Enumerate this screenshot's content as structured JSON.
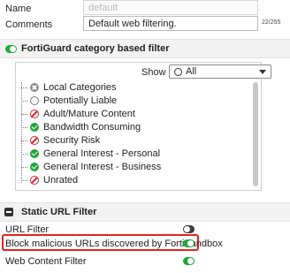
{
  "form": {
    "name_label": "Name",
    "name_value": "default",
    "comments_label": "Comments",
    "comments_value": "Default web filtering.",
    "comments_counter": "22/255"
  },
  "fortiguard": {
    "title": "FortiGuard category based filter",
    "enabled": true,
    "show_label": "Show",
    "show_selected": "All",
    "categories": [
      {
        "label": "Local Categories",
        "action_icon": "disable-icon"
      },
      {
        "label": "Potentially Liable",
        "action_icon": "circle-icon"
      },
      {
        "label": "Adult/Mature Content",
        "action_icon": "block-icon"
      },
      {
        "label": "Bandwidth Consuming",
        "action_icon": "allow-check-icon"
      },
      {
        "label": "Security Risk",
        "action_icon": "block-icon"
      },
      {
        "label": "General Interest - Personal",
        "action_icon": "allow-check-icon"
      },
      {
        "label": "General Interest - Business",
        "action_icon": "allow-check-icon"
      },
      {
        "label": "Unrated",
        "action_icon": "block-icon"
      }
    ]
  },
  "static_url": {
    "title": "Static URL Filter",
    "options": [
      {
        "label": "URL Filter",
        "enabled": false
      },
      {
        "label": "Block malicious URLs discovered by FortiSandbox",
        "enabled": true,
        "highlighted": true
      },
      {
        "label": "Web Content Filter",
        "enabled": true
      }
    ]
  },
  "colors": {
    "toggle_on": "#1ea83a",
    "block_red": "#d9262c",
    "allow_green": "#20a43a",
    "highlight_border": "#e1251b"
  }
}
